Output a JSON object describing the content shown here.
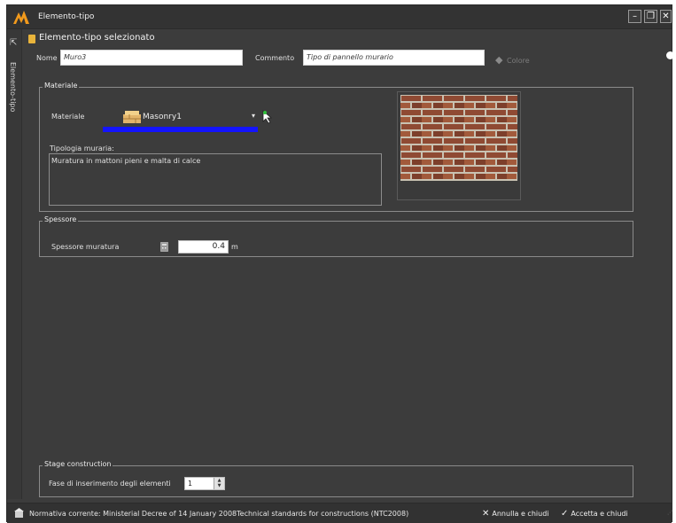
{
  "window": {
    "title": "Elemento-tipo",
    "buttons": {
      "minimize": "–",
      "restore": "❐",
      "close": "✕"
    }
  },
  "side_panel": {
    "label": "Elemento-tipo"
  },
  "header": {
    "section_title": "Elemento-tipo selezionato"
  },
  "fields": {
    "nome_label": "Nome",
    "nome_value": "Muro3",
    "commento_label": "Commento",
    "commento_value": "Tipo di pannello murario",
    "colore_label": "Colore"
  },
  "materiale_group": {
    "title": "Materiale",
    "materiale_label": "Materiale",
    "material_name": "Masonry1",
    "dropdown_glyph": "▾",
    "tipologia_label": "Tipologia muraria:",
    "tipologia_text": "Muratura in mattoni pieni e malta di calce",
    "highlight_color": "#1414ff"
  },
  "spessore_group": {
    "title": "Spessore",
    "spessore_label": "Spessore muratura",
    "spessore_value": "0.4",
    "unit": "m"
  },
  "stage_group": {
    "title": "Stage construction",
    "fase_label": "Fase di inserimento degli elementi",
    "fase_value": "1"
  },
  "status": {
    "normativa": "Normativa corrente: Ministerial Decree of 14 January 2008Technical standards for constructions (NTC2008)",
    "annulla_label": "Annulla e chiudi",
    "accetta_label": "Accetta e chiudi"
  },
  "icons": {
    "app_logo": "app-logo-icon",
    "brick": "brick-material-icon",
    "calculator": "calculator-icon",
    "cursor": "pointer-icon",
    "status": "building-icon"
  },
  "colors": {
    "background": "#3c3c3c",
    "accent_logo": "#f29a1c",
    "highlight": "#1414ff"
  }
}
